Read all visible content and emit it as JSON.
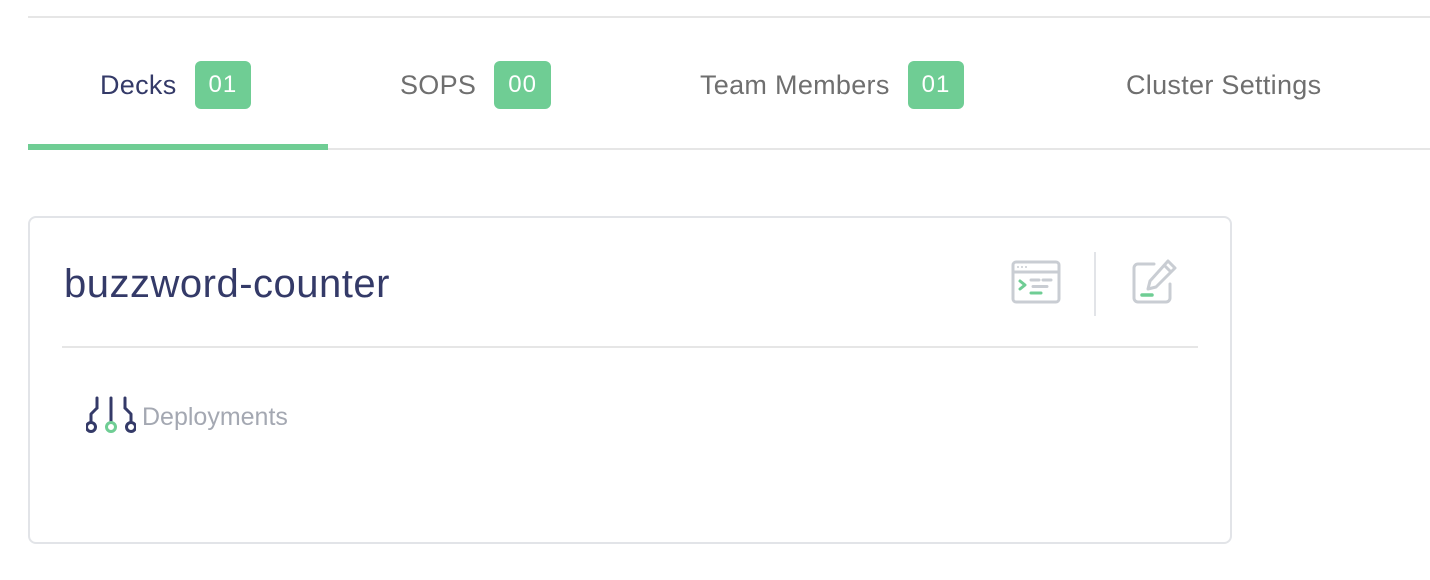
{
  "tabs": [
    {
      "label": "Decks",
      "count": "01",
      "active": true
    },
    {
      "label": "SOPS",
      "count": "00",
      "active": false
    },
    {
      "label": "Team Members",
      "count": "01",
      "active": false
    },
    {
      "label": "Cluster Settings",
      "count": null,
      "active": false
    }
  ],
  "card": {
    "title": "buzzword-counter",
    "actions": [
      {
        "icon": "terminal-icon"
      },
      {
        "icon": "edit-icon"
      }
    ],
    "link": {
      "icon": "deployments-icon",
      "label": "Deployments"
    }
  },
  "colors": {
    "accent": "#6fcd94",
    "title": "#343a68",
    "muted": "#a4a8b2",
    "tab_text": "#6f6f6f",
    "icon_gray": "#c9cdd3"
  }
}
